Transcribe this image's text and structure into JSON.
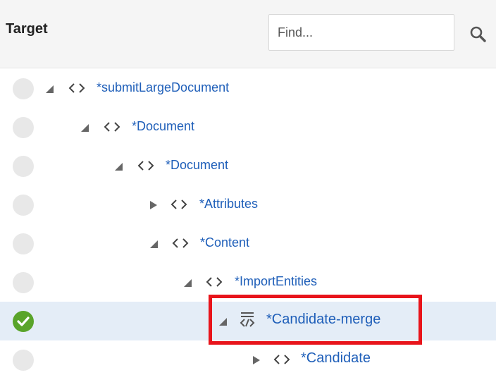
{
  "header": {
    "title": "Target",
    "search_placeholder": "Find...",
    "search_icon": "search-icon"
  },
  "tree": {
    "nodes": [
      {
        "label": "*submitLargeDocument",
        "expanded": true,
        "icon": "element-icon",
        "status": "none"
      },
      {
        "label": "*Document",
        "expanded": true,
        "icon": "element-icon",
        "status": "none"
      },
      {
        "label": "*Document",
        "expanded": true,
        "icon": "element-icon",
        "status": "none"
      },
      {
        "label": "*Attributes",
        "expanded": false,
        "icon": "element-icon",
        "status": "none"
      },
      {
        "label": "*Content",
        "expanded": true,
        "icon": "element-icon",
        "status": "none"
      },
      {
        "label": "*ImportEntities",
        "expanded": true,
        "icon": "element-icon",
        "status": "none"
      },
      {
        "label": "*Candidate-merge",
        "expanded": true,
        "icon": "merge-icon",
        "status": "mapped",
        "selected": true
      },
      {
        "label": "*Candidate",
        "expanded": false,
        "icon": "element-icon",
        "status": "none"
      }
    ]
  },
  "colors": {
    "link": "#1f5fb9",
    "selected_row": "#e4edf7",
    "mapped_status": "#59a42a",
    "highlight_border": "#e8141b"
  }
}
